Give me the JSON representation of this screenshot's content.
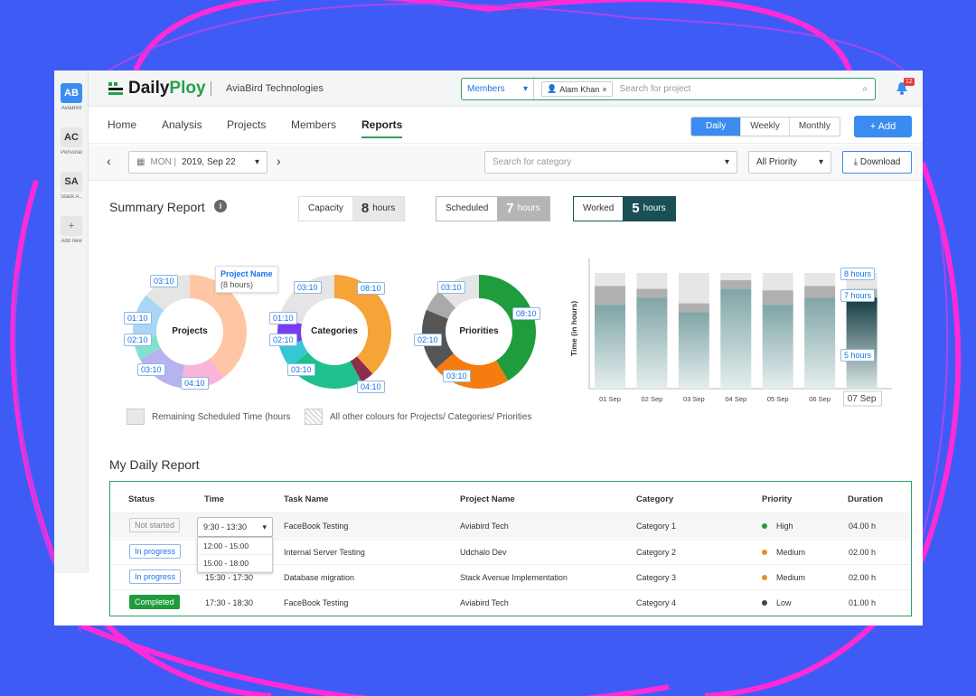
{
  "workspaces": [
    {
      "abbr": "AB",
      "name": "AviaBird",
      "active": true
    },
    {
      "abbr": "AC",
      "name": "Personal",
      "active": false
    },
    {
      "abbr": "SA",
      "name": "Stack A..",
      "active": false
    }
  ],
  "add_workspace": {
    "icon": "+",
    "label": "Add new"
  },
  "brand": {
    "part1": "Daily",
    "part2": "Ploy",
    "org": "AviaBird Technologies"
  },
  "search": {
    "scope": "Members",
    "chip": "Alam Khan",
    "placeholder": "Search for project"
  },
  "notifications": {
    "count": "12"
  },
  "nav_tabs": [
    "Home",
    "Analysis",
    "Projects",
    "Members",
    "Reports"
  ],
  "active_tab": "Reports",
  "period_toggle": [
    "Daily",
    "Weekly",
    "Monthly"
  ],
  "add_button": "+ Add",
  "date": {
    "day": "MON |",
    "value": "2019, Sep 22"
  },
  "category_search": {
    "placeholder": "Search for category"
  },
  "priority_filter": {
    "value": "All Priority"
  },
  "download_button": "Download",
  "summary": {
    "title": "Summary Report",
    "capacity": {
      "label": "Capacity",
      "value": "8",
      "unit": "hours"
    },
    "scheduled": {
      "label": "Scheduled",
      "value": "7",
      "unit": "hours"
    },
    "worked": {
      "label": "Worked",
      "value": "5",
      "unit": "hours"
    }
  },
  "donuts": {
    "projects": {
      "title": "Projects",
      "tooltip_title": "Project Name",
      "tooltip_sub": "(8 hours)",
      "labels": [
        "03:10",
        "01:10",
        "02:10",
        "03:10",
        "04:10"
      ]
    },
    "categories": {
      "title": "Categories",
      "labels": [
        "03:10",
        "08:10",
        "01:10",
        "02:10",
        "03:10",
        "04:10"
      ]
    },
    "priorities": {
      "title": "Priorities",
      "labels": [
        "03:10",
        "08:10",
        "02:10",
        "03:10"
      ]
    }
  },
  "colors": {
    "accent": "#3b8cf0",
    "green": "#2e9e5e",
    "worked": "#1b4f56"
  },
  "chart_data": {
    "type": "bar",
    "ylabel": "Time (in hours)",
    "categories": [
      "01 Sep",
      "02 Sep",
      "03 Sep",
      "04 Sep",
      "05 Sep",
      "06 Sep",
      "07 Sep"
    ],
    "series": [
      {
        "values": [
          5.8,
          6.3,
          5.3,
          6.9,
          5.8,
          6.3,
          6.3
        ]
      },
      {
        "values": [
          7.1,
          6.9,
          5.9,
          7.5,
          6.8,
          7.1,
          6.9
        ]
      },
      {
        "values": [
          8,
          8,
          8,
          8,
          8,
          8,
          8
        ]
      }
    ],
    "annotations": [
      "8 hours",
      "7 hours",
      "5 hours"
    ],
    "ylim": [
      0,
      9
    ],
    "highlight_category": "07 Sep"
  },
  "legend": {
    "remaining": "Remaining Scheduled Time (hours",
    "others": "All other colours for Projects/ Categories/ Priorities"
  },
  "daily": {
    "title": "My Daily Report",
    "headers": [
      "Status",
      "Time",
      "Task Name",
      "Project Name",
      "Category",
      "Priority",
      "Duration"
    ],
    "rows": [
      {
        "status": "Not started",
        "time": "9:30 - 13:30",
        "task": "FaceBook Testing",
        "project": "Aviabird Tech",
        "category": "Category 1",
        "priority": "High",
        "pcolor": "#1f9d3c",
        "duration": "04.00 h"
      },
      {
        "status": "In progress",
        "time": "12:00 - 15:00",
        "task": "Internal Server Testing",
        "project": "Udchalo Dev",
        "category": "Category 2",
        "priority": "Medium",
        "pcolor": "#f08a24",
        "duration": "02.00 h"
      },
      {
        "status": "In progress",
        "time": "15:30 - 17:30",
        "task": "Database migration",
        "project": "Stack Avenue Implementation",
        "category": "Category 3",
        "priority": "Medium",
        "pcolor": "#f08a24",
        "duration": "02.00 h"
      },
      {
        "status": "Completed",
        "time": "17:30 - 18:30",
        "task": "FaceBook Testing",
        "project": "Aviabird Tech",
        "category": "Category 4",
        "priority": "Low",
        "pcolor": "#444444",
        "duration": "01.00 h"
      }
    ],
    "time_dropdown": [
      "12:00 - 15:00",
      "15:00 - 18:00"
    ]
  }
}
